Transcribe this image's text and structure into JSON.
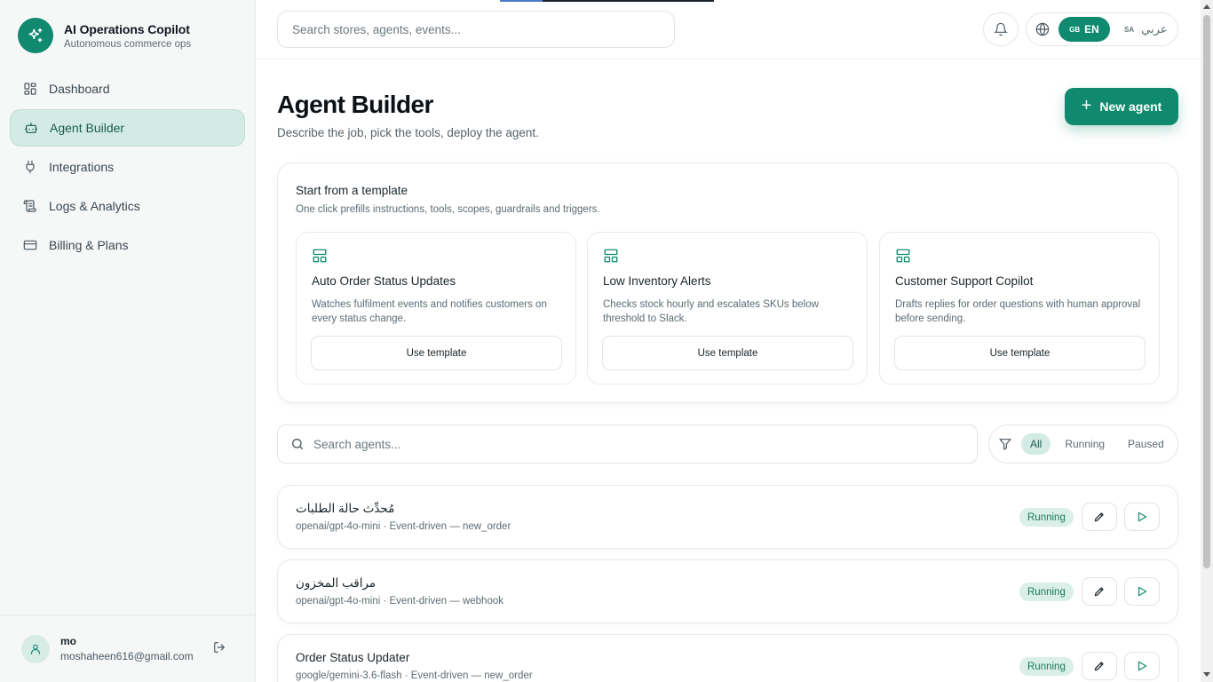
{
  "brand": {
    "title": "AI Operations Copilot",
    "subtitle": "Autonomous commerce ops"
  },
  "nav": [
    {
      "label": "Dashboard",
      "icon": "dashboard-icon",
      "active": false
    },
    {
      "label": "Agent Builder",
      "icon": "bot-icon",
      "active": true
    },
    {
      "label": "Integrations",
      "icon": "plug-icon",
      "active": false
    },
    {
      "label": "Logs & Analytics",
      "icon": "scroll-icon",
      "active": false
    },
    {
      "label": "Billing & Plans",
      "icon": "credit-card-icon",
      "active": false
    }
  ],
  "user": {
    "name": "mo",
    "email": "moshaheen616@gmail.com"
  },
  "topbar": {
    "search_placeholder": "Search stores, agents, events...",
    "lang_en_flag": "GB",
    "lang_en": "EN",
    "lang_ar_flag": "SA",
    "lang_ar": "عربي"
  },
  "page": {
    "title": "Agent Builder",
    "subtitle": "Describe the job, pick the tools, deploy the agent.",
    "new_agent_label": "New agent"
  },
  "templates": {
    "heading": "Start from a template",
    "subheading": "One click prefills instructions, tools, scopes, guardrails and triggers.",
    "items": [
      {
        "name": "Auto Order Status Updates",
        "description": "Watches fulfilment events and notifies customers on every status change.",
        "button": "Use template"
      },
      {
        "name": "Low Inventory Alerts",
        "description": "Checks stock hourly and escalates SKUs below threshold to Slack.",
        "button": "Use template"
      },
      {
        "name": "Customer Support Copilot",
        "description": "Drafts replies for order questions with human approval before sending.",
        "button": "Use template"
      }
    ]
  },
  "agents_toolbar": {
    "search_placeholder": "Search agents...",
    "filters": [
      "All",
      "Running",
      "Paused"
    ],
    "active_filter": "All"
  },
  "agents": [
    {
      "name": "مُحدِّث حالة الطلبات",
      "model": "openai/gpt-4o-mini",
      "trigger": "Event-driven — new_order",
      "status": "Running"
    },
    {
      "name": "مراقب المخزون",
      "model": "openai/gpt-4o-mini",
      "trigger": "Event-driven — webhook",
      "status": "Running"
    },
    {
      "name": "Order Status Updater",
      "model": "google/gemini-3.6-flash",
      "trigger": "Event-driven — new_order",
      "status": "Running"
    }
  ],
  "colors": {
    "brand": "#0f8a6e",
    "active_bg": "#d3ebe4",
    "status_bg": "#d9efe7"
  }
}
